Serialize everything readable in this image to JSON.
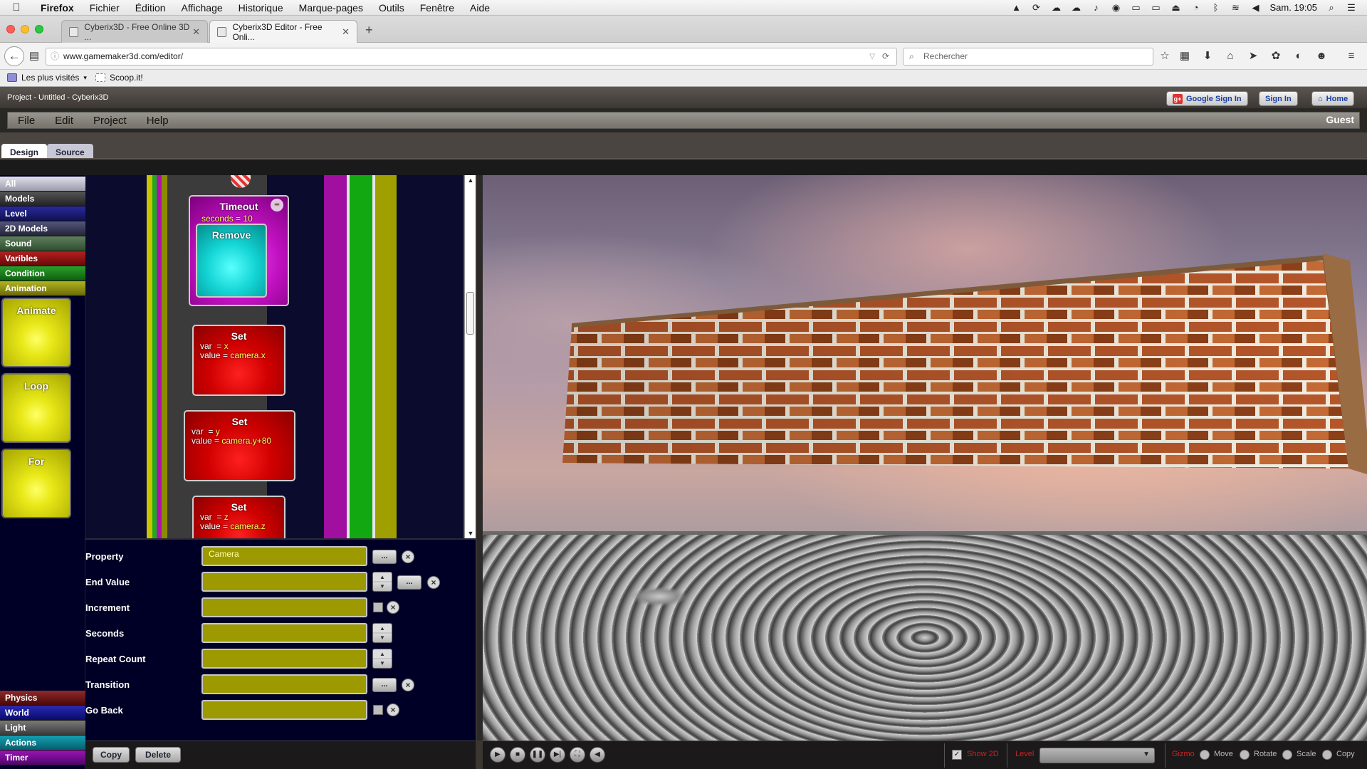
{
  "mac_menu": {
    "app": "Firefox",
    "items": [
      "Fichier",
      "Édition",
      "Affichage",
      "Historique",
      "Marque-pages",
      "Outils",
      "Fenêtre",
      "Aide"
    ],
    "clock": "Sam. 19:05"
  },
  "browser": {
    "tabs": [
      {
        "title": "Cyberix3D - Free Online 3D ..."
      },
      {
        "title": "Cyberix3D Editor - Free Onli..."
      }
    ],
    "new_tab": "+",
    "url": "www.gamemaker3d.com/editor/",
    "search_placeholder": "Rechercher",
    "bookmarks": [
      "Les plus visités",
      "Scoop.it!"
    ]
  },
  "app": {
    "window_title": "Project - Untitled - Cyberix3D",
    "header_buttons": [
      "Google Sign In",
      "Sign In",
      "Home"
    ],
    "menu": [
      "File",
      "Edit",
      "Project",
      "Help"
    ],
    "user": "Guest",
    "tabs": [
      "Design",
      "Source"
    ]
  },
  "palette": {
    "categories_top": [
      {
        "label": "All",
        "color": "#c8c8d4",
        "text": "#fff"
      },
      {
        "label": "Models",
        "color": "#3a3a3a"
      },
      {
        "label": "Level",
        "color": "#1a1a6e"
      },
      {
        "label": "2D Models",
        "color": "#3a3a5a"
      },
      {
        "label": "Sound",
        "color": "#3e5e3e"
      },
      {
        "label": "Varibles",
        "color": "#8a1010"
      },
      {
        "label": "Condition",
        "color": "#1a7a1a"
      },
      {
        "label": "Animation",
        "color": "#8c8c10"
      }
    ],
    "blocks": [
      "Animate",
      "Loop",
      "For"
    ],
    "categories_bottom": [
      {
        "label": "Physics",
        "color": "#6a1a1a"
      },
      {
        "label": "World",
        "color": "#1a1a8a"
      },
      {
        "label": "Light",
        "color": "#5a5a5a"
      },
      {
        "label": "Actions",
        "color": "#0a7a8a"
      },
      {
        "label": "Timer",
        "color": "#6a0a7a"
      }
    ]
  },
  "script_blocks": {
    "timeout": {
      "title": "Timeout",
      "param": "seconds",
      "value": "10",
      "minus": "−"
    },
    "remove": {
      "title": "Remove"
    },
    "set_blocks": [
      {
        "title": "Set",
        "var_key": "var",
        "var_val": "x",
        "value_key": "value",
        "value_val": "camera.x"
      },
      {
        "title": "Set",
        "var_key": "var",
        "var_val": "y",
        "value_key": "value",
        "value_val": "camera.y+80"
      },
      {
        "title": "Set",
        "var_key": "var",
        "var_val": "z",
        "value_key": "value",
        "value_val": "camera.z"
      }
    ]
  },
  "properties": {
    "rows": [
      {
        "label": "Property",
        "value": "Camera"
      },
      {
        "label": "End Value",
        "value": ""
      },
      {
        "label": "Increment",
        "value": ""
      },
      {
        "label": "Seconds",
        "value": ""
      },
      {
        "label": "Repeat Count",
        "value": ""
      },
      {
        "label": "Transition",
        "value": ""
      },
      {
        "label": "Go Back",
        "value": ""
      }
    ],
    "dots_label": "...",
    "clear_label": "×",
    "copy_label": "Copy",
    "delete_label": "Delete"
  },
  "viewport_bar": {
    "show2d": "Show 2D",
    "level_label": "Level",
    "gizmo_label": "Gizmo",
    "modes": [
      "Move",
      "Rotate",
      "Scale",
      "Copy"
    ]
  },
  "colors": {
    "script_bg": "#0b0b2e",
    "prop_field": "#9c9a00",
    "brick": "#b5562a"
  }
}
